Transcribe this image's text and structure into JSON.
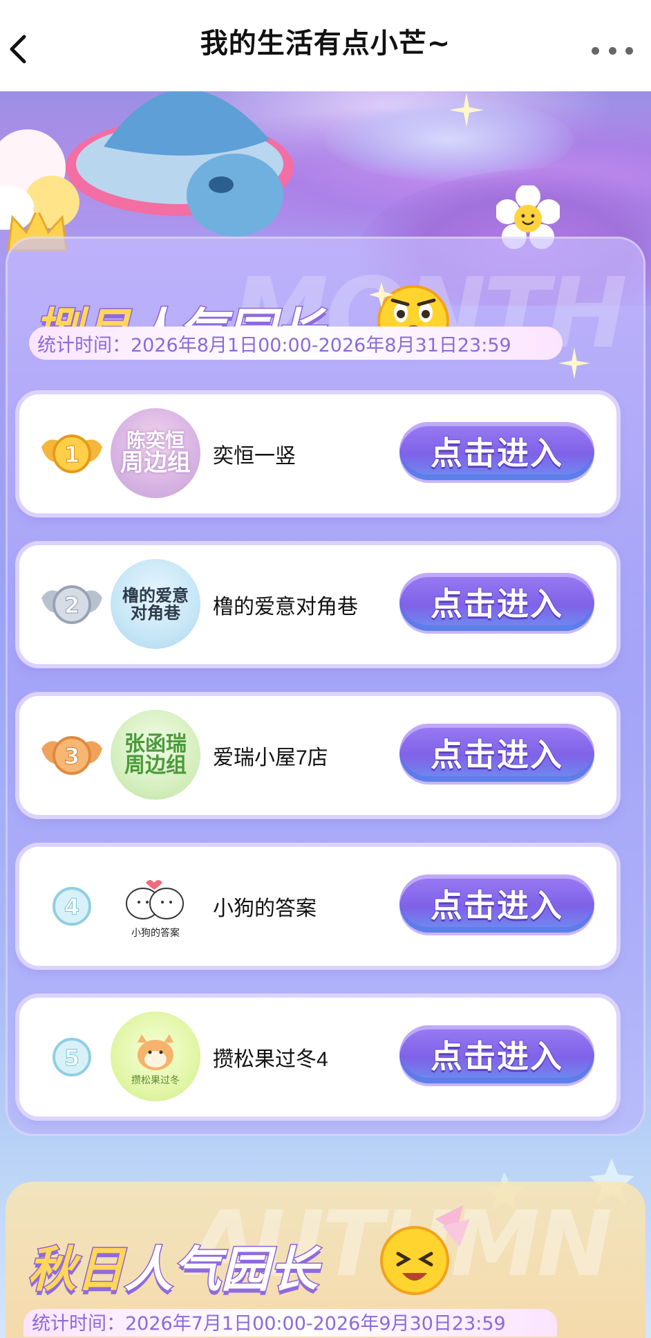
{
  "navbar": {
    "title": "我的生活有点小芒~",
    "back_icon": "chevron-left-icon",
    "more_icon": "more-dots-icon"
  },
  "monthly": {
    "watermark": "MONTH",
    "title_part1": "捌月",
    "title_part2": "人气园长",
    "date_range": "统计时间：2026年8月1日00:00-2026年8月31日23:59",
    "button_label": "点击进入",
    "ranks": [
      {
        "rank": "1",
        "name": "奕恒一竖",
        "avatar_text": [
          "陈奕恒",
          "周边组"
        ],
        "medal": "gold"
      },
      {
        "rank": "2",
        "name": "橹的爱意对角巷",
        "avatar_text": [
          "橹的爱意",
          "对角巷"
        ],
        "medal": "silver"
      },
      {
        "rank": "3",
        "name": "爱瑞小屋7店",
        "avatar_text": [
          "张函瑞",
          "周边组"
        ],
        "medal": "bronze"
      },
      {
        "rank": "4",
        "name": "小狗的答案",
        "avatar_text": [
          "小狗的答案"
        ],
        "medal": "plain"
      },
      {
        "rank": "5",
        "name": "攒松果过冬4",
        "avatar_text": [
          "攒松果过冬"
        ],
        "medal": "plain"
      }
    ]
  },
  "autumn": {
    "watermark": "AUTUMN",
    "title_part1": "秋日",
    "title_part2": "人气园长",
    "date_range": "统计时间：2026年7月1日00:00-2026年9月30日23:59"
  },
  "colors": {
    "accent_purple": "#7f62e8",
    "title_yellow": "#ffd65a",
    "date_text": "#8b6ad7"
  }
}
